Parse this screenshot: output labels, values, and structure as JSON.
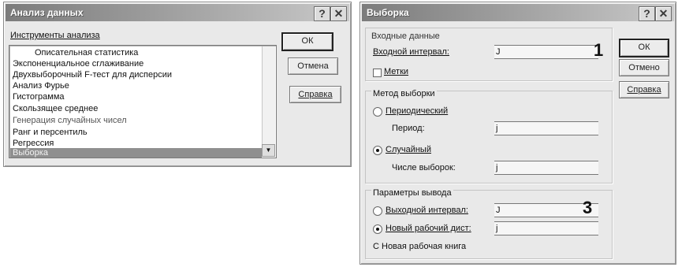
{
  "left_dialog": {
    "title": "Анализ данных",
    "help_btn": "?",
    "close_btn": "✕",
    "tools_label": "Инструменты анализа",
    "tools": [
      "Описательная статистика",
      "Экспоненциальное сглаживание",
      "Двухвыборочный F-тест для дисперсии",
      "Анализ Фурье",
      "Гистограмма",
      "Скользящее среднее",
      "Генерация случайных чисел",
      "Ранг и персентиль",
      "Регрессия",
      "Выборка"
    ],
    "selected_tool": "Выборка",
    "ok": "ОК",
    "cancel": "Отмена",
    "help": "Справка"
  },
  "right_dialog": {
    "title": "Выборка",
    "help_btn": "?",
    "close_btn": "✕",
    "input_group": "Входные данные",
    "input_range_label": "Входной интервал:",
    "input_range_value": "J",
    "labels_checkbox": "Метки",
    "method_group": "Метод выборки",
    "periodic_label": "Периодический",
    "period_label": "Период:",
    "period_value": "j",
    "random_label": "Случайный",
    "sample_count_label": "Числе выборок:",
    "sample_count_value": "j",
    "output_group": "Параметры вывода",
    "output_range_label": "Выходной интервал:",
    "output_range_value": "J",
    "new_sheet_label": "Новый рабочий дист:",
    "new_sheet_value": "j",
    "new_book_label": "С Новая рабочая книга",
    "ok": "ОК",
    "cancel": "Отмено",
    "help": "Справка",
    "marker_1": "1",
    "marker_3": "3"
  }
}
